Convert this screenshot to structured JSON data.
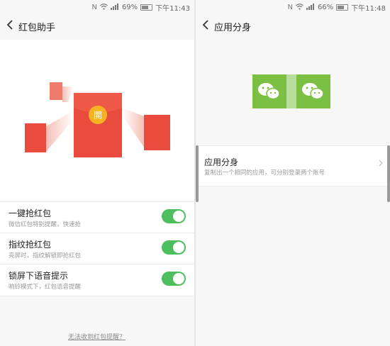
{
  "left": {
    "status": {
      "battery": "69%",
      "time": "下午11:43",
      "battery_level": 0.69
    },
    "title": "红包助手",
    "envelope_char": "開",
    "rows": [
      {
        "title": "一键抢红包",
        "subtitle": "微信红包特别提醒，快速抢",
        "enabled": true
      },
      {
        "title": "指纹抢红包",
        "subtitle": "亮屏时，指纹解锁即抢红包",
        "enabled": true
      },
      {
        "title": "锁屏下语音提示",
        "subtitle": "响铃模式下，红包语音提醒",
        "enabled": true
      }
    ],
    "link": "无法收到红包提醒？"
  },
  "right": {
    "status": {
      "battery": "66%",
      "time": "下午11:48",
      "battery_level": 0.66
    },
    "title": "应用分身",
    "card": {
      "title": "应用分身",
      "subtitle": "复制出一个相同的应用，可分别登录两个账号"
    }
  },
  "colors": {
    "accent_green": "#4cbe5e",
    "red_envelope": "#e94b3c",
    "gold_seal": "#f6b321",
    "wechat_green": "#7bc043"
  }
}
